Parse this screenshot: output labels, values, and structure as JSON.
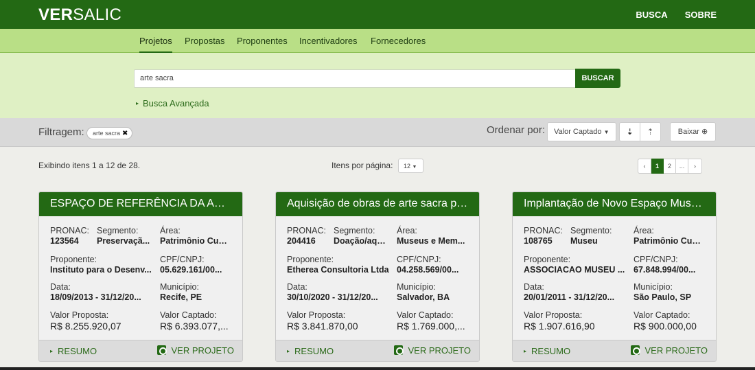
{
  "header": {
    "brand_bold": "VER",
    "brand_rest": "SALIC",
    "nav": [
      "BUSCA",
      "SOBRE"
    ]
  },
  "subnav": {
    "items": [
      "Projetos",
      "Propostas",
      "Proponentes",
      "Incentivadores",
      "Fornecedores"
    ],
    "active": "Projetos"
  },
  "search": {
    "value": "arte sacra",
    "button": "BUSCAR",
    "advanced": "Busca Avançada"
  },
  "filter": {
    "label": "Filtragem:",
    "chip": "arte sacra",
    "order_label": "Ordenar por:",
    "order_value": "Valor Captado",
    "download": "Baixar"
  },
  "listing": {
    "showing": "Exibindo itens 1 a 12 de 28.",
    "per_page_label": "Itens por página:",
    "per_page_value": "12",
    "pages": [
      "‹",
      "1",
      "2",
      "...",
      "›"
    ],
    "current_page": "1"
  },
  "cards": [
    {
      "title": "ESPAÇO DE REFERÊNCIA DA ART...",
      "pronac_label": "PRONAC:",
      "pronac": "123564",
      "segmento_label": "Segmento:",
      "segmento": "Preservaçã...",
      "area_label": "Área:",
      "area": "Patrimônio Cult...",
      "proponente_label": "Proponente:",
      "proponente": "Instituto para o Desenv...",
      "cnpj_label": "CPF/CNPJ:",
      "cnpj": "05.629.161/00...",
      "data_label": "Data:",
      "data": "18/09/2013 - 31/12/20...",
      "municipio_label": "Município:",
      "municipio": "Recife, PE",
      "proposta_label": "Valor Proposta:",
      "proposta": "R$ 8.255.920,07",
      "captado_label": "Valor Captado:",
      "captado": "R$ 6.393.077,...",
      "resumo": "RESUMO",
      "ver": "VER PROJETO"
    },
    {
      "title": "Aquisição de obras de arte sacra pa...",
      "pronac_label": "PRONAC:",
      "pronac": "204416",
      "segmento_label": "Segmento:",
      "segmento": "Doação/aqu...",
      "area_label": "Área:",
      "area": "Museus e Mem...",
      "proponente_label": "Proponente:",
      "proponente": "Etherea Consultoria Ltda",
      "cnpj_label": "CPF/CNPJ:",
      "cnpj": "04.258.569/00...",
      "data_label": "Data:",
      "data": "30/10/2020 - 31/12/20...",
      "municipio_label": "Município:",
      "municipio": "Salvador, BA",
      "proposta_label": "Valor Proposta:",
      "proposta": "R$ 3.841.870,00",
      "captado_label": "Valor Captado:",
      "captado": "R$ 1.769.000,...",
      "resumo": "RESUMO",
      "ver": "VER PROJETO"
    },
    {
      "title": "Implantação de Novo Espaço Muse...",
      "pronac_label": "PRONAC:",
      "pronac": "108765",
      "segmento_label": "Segmento:",
      "segmento": "Museu",
      "area_label": "Área:",
      "area": "Patrimônio Cult...",
      "proponente_label": "Proponente:",
      "proponente": "ASSOCIACAO MUSEU ...",
      "cnpj_label": "CPF/CNPJ:",
      "cnpj": "67.848.994/00...",
      "data_label": "Data:",
      "data": "20/01/2011 - 31/12/20...",
      "municipio_label": "Município:",
      "municipio": "São Paulo, SP",
      "proposta_label": "Valor Proposta:",
      "proposta": "R$ 1.907.616,90",
      "captado_label": "Valor Captado:",
      "captado": "R$ 900.000,00",
      "resumo": "RESUMO",
      "ver": "VER PROJETO"
    }
  ]
}
